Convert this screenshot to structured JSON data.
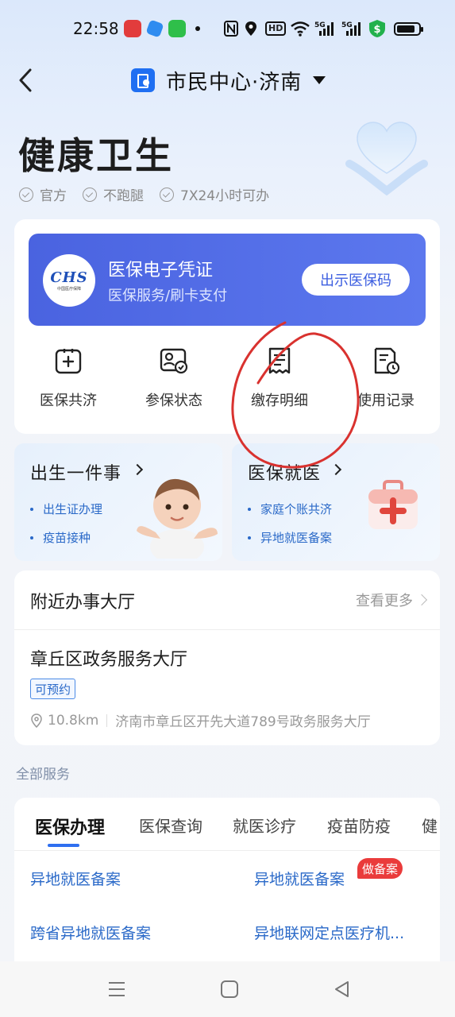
{
  "status_bar": {
    "time": "22:58",
    "icons": [
      "app-red-icon",
      "app-blue-icon",
      "app-green-icon",
      "dot-icon",
      "nfc-icon",
      "location-icon",
      "hd-icon",
      "wifi-icon",
      "5g-signal-icon",
      "5g-signal-icon",
      "shield-dollar-icon",
      "battery-icon"
    ],
    "hd_label": "HD",
    "fiveg_label": "5G"
  },
  "nav": {
    "title": "市民中心·济南"
  },
  "header": {
    "title": "健康卫生",
    "tags": [
      "官方",
      "不跑腿",
      "7X24小时可办"
    ]
  },
  "insurance_card": {
    "logo_text": "CHS",
    "logo_sub": "中国医疗保障",
    "title": "医保电子凭证",
    "subtitle": "医保服务/刷卡支付",
    "button": "出示医保码",
    "quick_actions": [
      {
        "label": "医保共济",
        "icon": "medical-plus-icon"
      },
      {
        "label": "参保状态",
        "icon": "id-card-check-icon"
      },
      {
        "label": "缴存明细",
        "icon": "receipt-icon"
      },
      {
        "label": "使用记录",
        "icon": "document-clock-icon"
      }
    ]
  },
  "promos": [
    {
      "title": "出生一件事",
      "links": [
        "出生证办理",
        "疫苗接种"
      ],
      "image": "baby-image"
    },
    {
      "title": "医保就医",
      "links": [
        "家庭个账共济",
        "异地就医备案"
      ],
      "image": "first-aid-kit-image"
    }
  ],
  "nearby": {
    "title": "附近办事大厅",
    "more": "查看更多",
    "hall_name": "章丘区政务服务大厅",
    "badge": "可预约",
    "distance": "10.8km",
    "address": "济南市章丘区开先大道789号政务服务大厅"
  },
  "services": {
    "section_label": "全部服务",
    "tabs": [
      "医保办理",
      "医保查询",
      "就医诊疗",
      "疫苗防疫",
      "健"
    ],
    "active_tab": 0,
    "items": [
      {
        "label": "异地就医备案",
        "badge": ""
      },
      {
        "label": "异地就医备案",
        "badge": "做备案"
      },
      {
        "label": "跨省异地就医备案",
        "badge": ""
      },
      {
        "label": "异地联网定点医疗机...",
        "badge": ""
      }
    ]
  },
  "colors": {
    "primary": "#2f6ff0",
    "banner": "#5070e6",
    "link": "#2a69c8",
    "badge_red": "#ea3b3b",
    "annotation": "#d9322f"
  }
}
